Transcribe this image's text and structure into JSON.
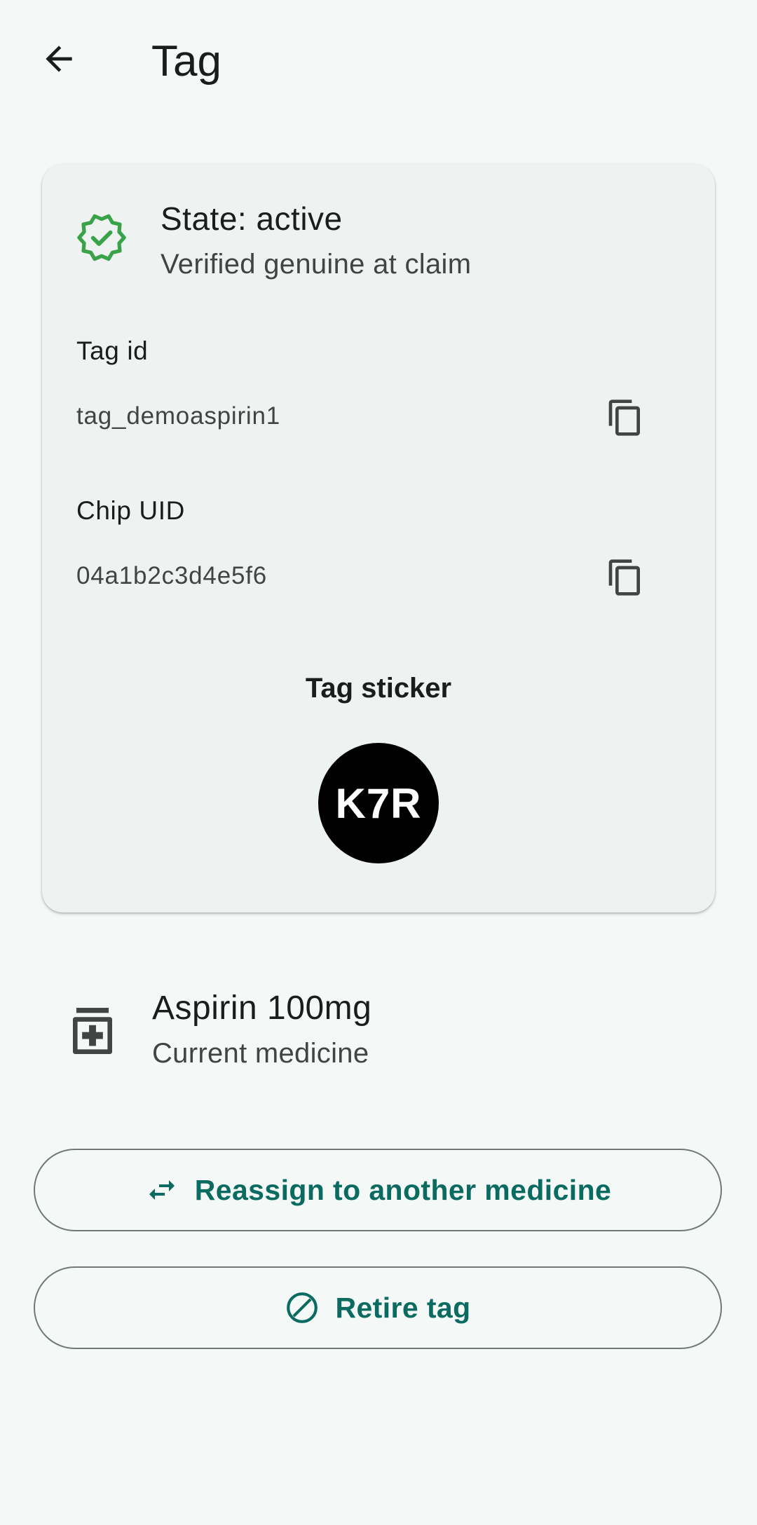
{
  "app_bar": {
    "title": "Tag",
    "back_icon": "arrow-back-icon"
  },
  "status_card": {
    "state_title": "State: active",
    "state_subtitle": "Verified genuine at claim",
    "state_icon": "verified-badge-icon",
    "state_icon_color": "#3aa34a",
    "fields": [
      {
        "label": "Tag id",
        "value": "tag_demoaspirin1",
        "copy_icon": "copy-icon"
      },
      {
        "label": "Chip UID",
        "value": "04a1b2c3d4e5f6",
        "copy_icon": "copy-icon"
      }
    ],
    "sticker": {
      "label": "Tag sticker",
      "code": "K7R",
      "background": "#000000",
      "text_color": "#ffffff"
    }
  },
  "medicine": {
    "name": "Aspirin 100mg",
    "subtitle": "Current medicine",
    "icon": "medicine-bottle-icon"
  },
  "actions": {
    "reassign": {
      "label": "Reassign to another medicine",
      "icon": "swap-arrows-icon"
    },
    "retire": {
      "label": "Retire tag",
      "icon": "block-icon"
    }
  },
  "colors": {
    "background": "#f4f9f7",
    "card": "#eef3f1",
    "accent": "#0b6b60",
    "outline": "#6f7975"
  }
}
